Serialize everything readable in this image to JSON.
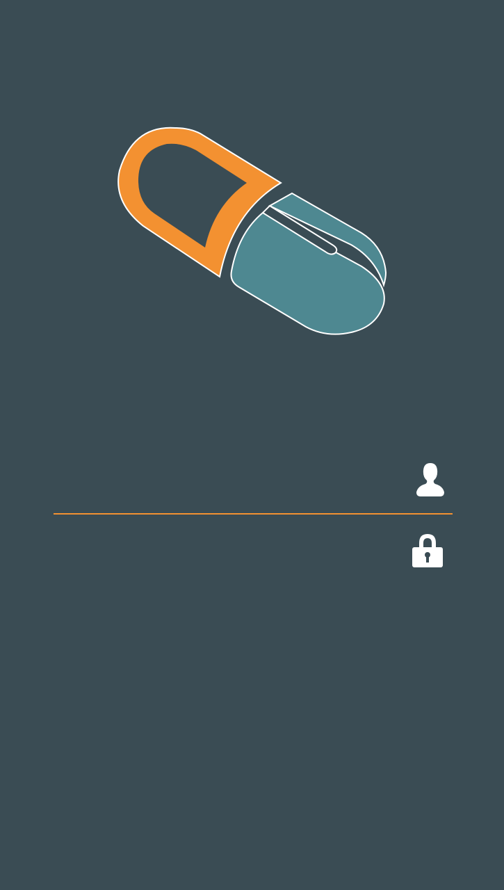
{
  "colors": {
    "background": "#3a4c54",
    "accent": "#f39131",
    "capsule_teal": "#4e8891",
    "outline": "#ffffff"
  },
  "logo": {
    "icon": "capsule-pill-icon"
  },
  "login": {
    "username": {
      "value": "",
      "placeholder": "",
      "icon": "user-icon"
    },
    "password": {
      "value": "",
      "placeholder": "",
      "icon": "lock-icon"
    }
  }
}
